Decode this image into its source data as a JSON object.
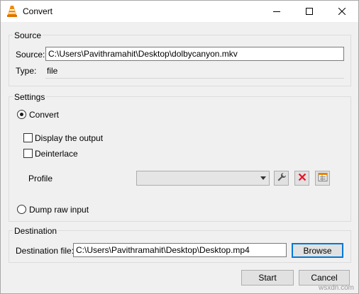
{
  "window": {
    "title": "Convert",
    "minimize_icon": "minimize-icon",
    "maximize_icon": "maximize-icon",
    "close_icon": "close-icon",
    "app_icon": "vlc-cone-icon"
  },
  "source": {
    "group_title": "Source",
    "source_label": "Source:",
    "source_value": "C:\\Users\\Pavithramahit\\Desktop\\dolbycanyon.mkv",
    "type_label": "Type:",
    "type_value": "file"
  },
  "settings": {
    "group_title": "Settings",
    "convert_label": "Convert",
    "convert_selected": true,
    "display_output_label": "Display the output",
    "display_output_checked": false,
    "deinterlace_label": "Deinterlace",
    "deinterlace_checked": false,
    "profile_label": "Profile",
    "profile_value": "",
    "profile_edit_icon": "wrench-icon",
    "profile_delete_icon": "red-x-icon",
    "profile_new_icon": "new-profile-icon",
    "dump_raw_label": "Dump raw input",
    "dump_raw_selected": false
  },
  "destination": {
    "group_title": "Destination",
    "file_label": "Destination file:",
    "file_value": "C:\\Users\\Pavithramahit\\Desktop\\Desktop.mp4",
    "browse_label": "Browse"
  },
  "actions": {
    "start_label": "Start",
    "cancel_label": "Cancel"
  },
  "watermark": "wsxdn.com",
  "colors": {
    "accent": "#0078d7",
    "delete_red": "#e81123",
    "vlc_orange": "#f08a00"
  }
}
